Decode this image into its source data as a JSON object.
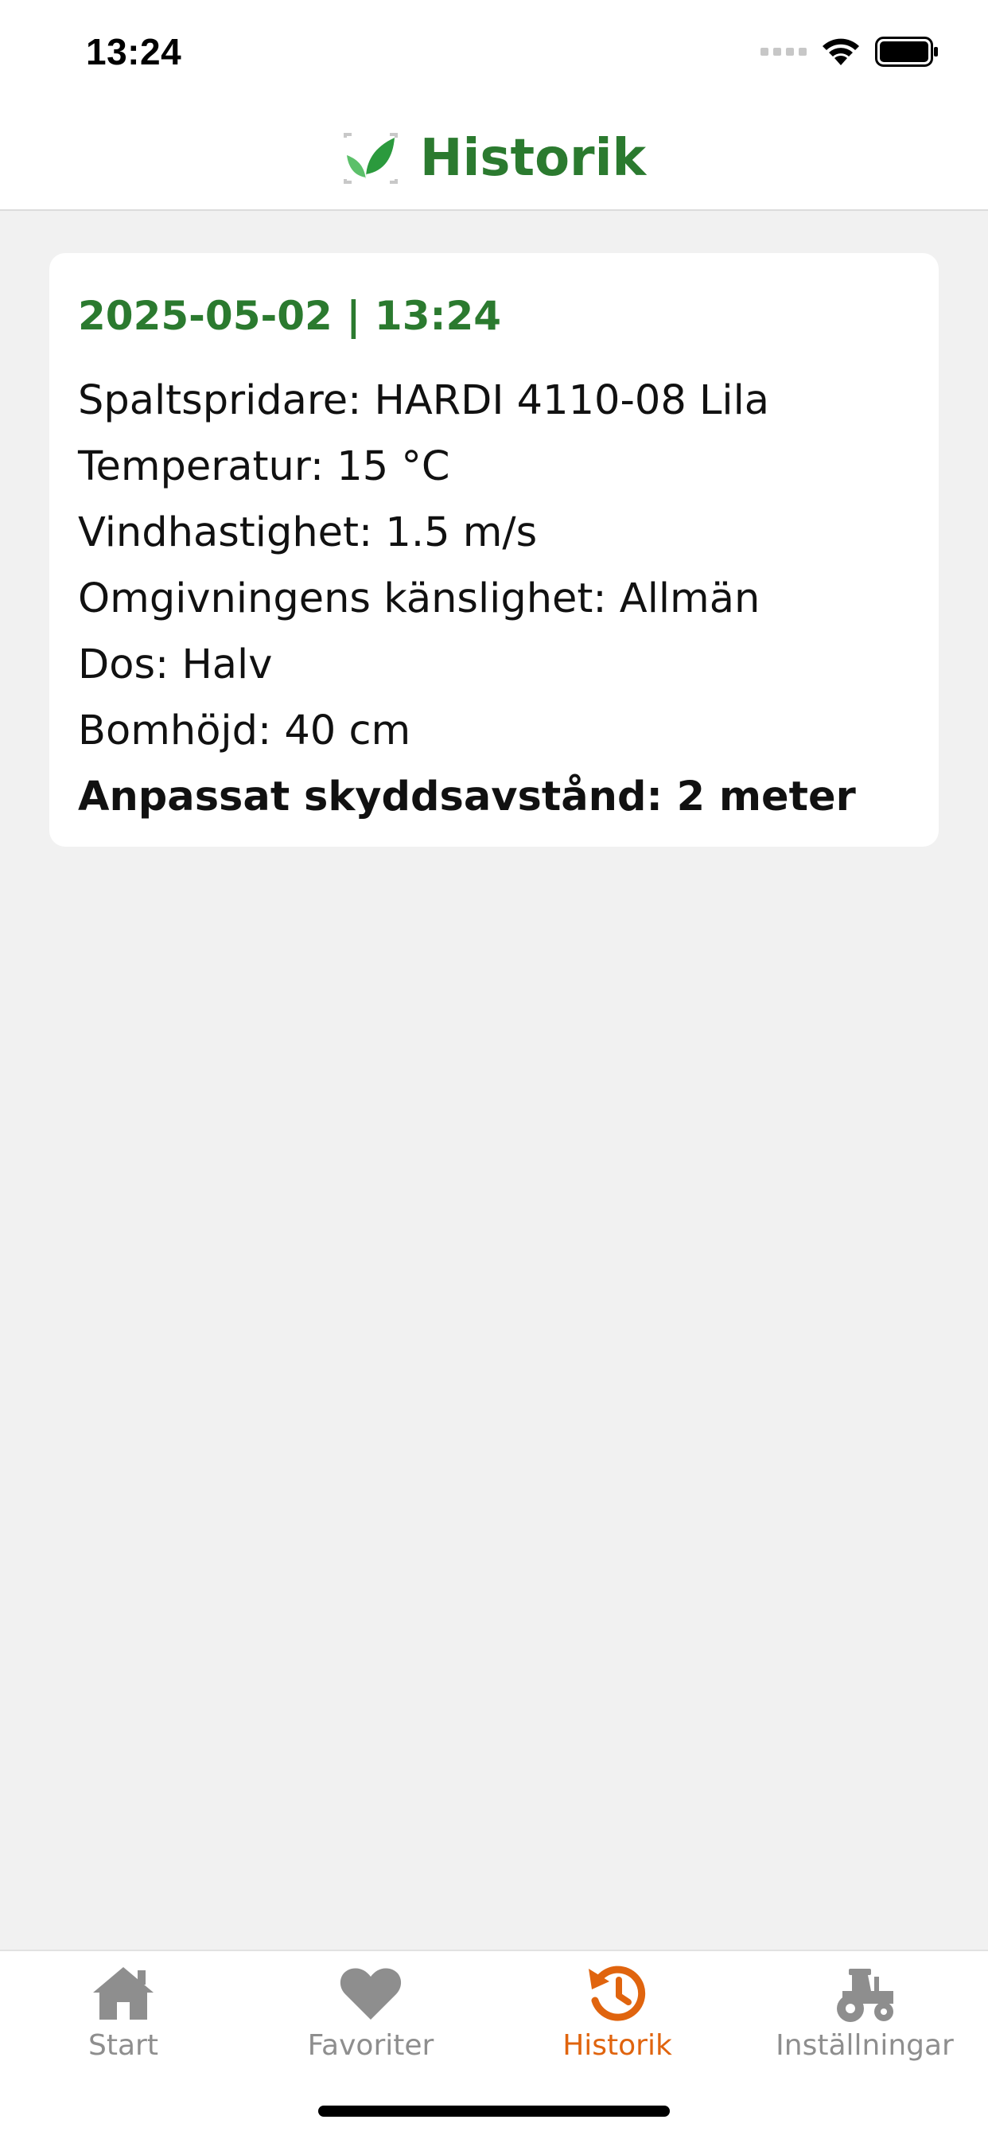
{
  "status": {
    "time": "13:24"
  },
  "header": {
    "title": "Historik",
    "icon": "leaf-logo-icon"
  },
  "entry": {
    "datetime": "2025-05-02 | 13:24",
    "lines": [
      "Spaltspridare: HARDI 4110-08 Lila",
      "Temperatur: 15 °C",
      "Vindhastighet: 1.5 m/s",
      "Omgivningens känslighet: Allmän",
      "Dos: Halv",
      "Bomhöjd: 40 cm"
    ],
    "result": "Anpassat skyddsavstånd: 2 meter"
  },
  "tabs": [
    {
      "label": "Start",
      "icon": "home-icon",
      "active": false
    },
    {
      "label": "Favoriter",
      "icon": "heart-icon",
      "active": false
    },
    {
      "label": "Historik",
      "icon": "history-icon",
      "active": true
    },
    {
      "label": "Inställningar",
      "icon": "tractor-icon",
      "active": false
    }
  ],
  "colors": {
    "brand_green": "#2b7a2f",
    "active_orange": "#e0640e",
    "inactive_gray": "#8e8e8e",
    "background": "#f1f1f1"
  }
}
